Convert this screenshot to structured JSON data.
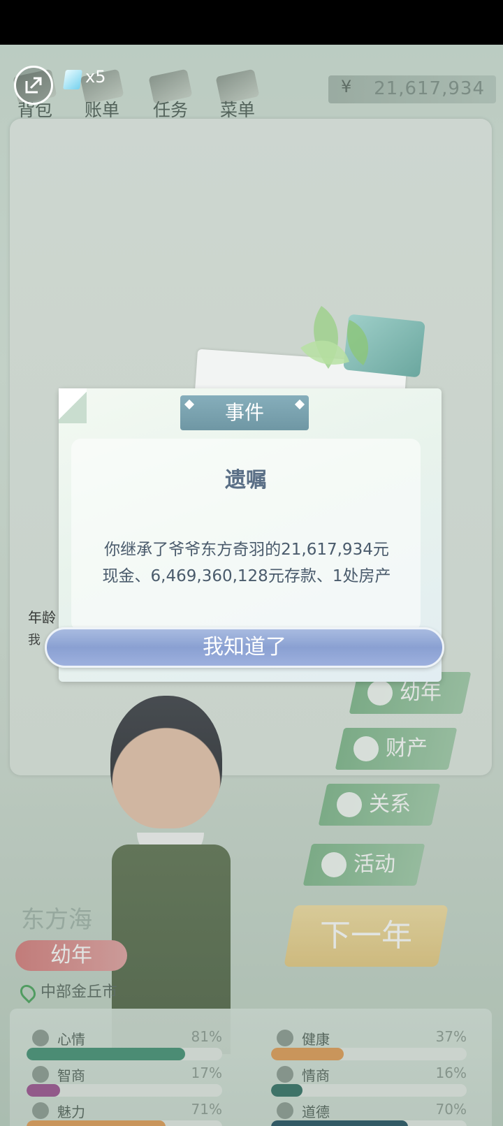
{
  "hud": {
    "gem_count": "x5",
    "money_symbol": "¥",
    "money": "21,617,934"
  },
  "topnav": [
    {
      "label": "背包"
    },
    {
      "label": "账单"
    },
    {
      "label": "任务"
    },
    {
      "label": "菜单"
    }
  ],
  "partial_text": {
    "age_label": "年龄",
    "line": "我"
  },
  "side_buttons": [
    {
      "label": "幼年",
      "icon": "baby-icon"
    },
    {
      "label": "财产",
      "icon": "house-icon"
    },
    {
      "label": "关系",
      "icon": "people-icon"
    },
    {
      "label": "活动",
      "icon": "bubbles-icon"
    }
  ],
  "character": {
    "name": "东方海",
    "stage": "幼年",
    "location": "中部金丘市"
  },
  "next_year_label": "下一年",
  "stats": [
    {
      "name": "心情",
      "percent": "81%",
      "value": 0.81,
      "color": "#3f8f73"
    },
    {
      "name": "健康",
      "percent": "37%",
      "value": 0.37,
      "color": "#e09a52"
    },
    {
      "name": "智商",
      "percent": "17%",
      "value": 0.17,
      "color": "#9a4f8f"
    },
    {
      "name": "情商",
      "percent": "16%",
      "value": 0.16,
      "color": "#2f6f63"
    },
    {
      "name": "魅力",
      "percent": "71%",
      "value": 0.71,
      "color": "#e09a52"
    },
    {
      "name": "道德",
      "percent": "70%",
      "value": 0.7,
      "color": "#1f4f5f"
    }
  ],
  "dialog": {
    "tab": "事件",
    "title": "遗嘱",
    "body_line1": "你继承了爷爷东方奇羽的21,617,934元",
    "body_line2": "现金、6,469,360,128元存款、1处房产",
    "ok_button": "我知道了"
  }
}
